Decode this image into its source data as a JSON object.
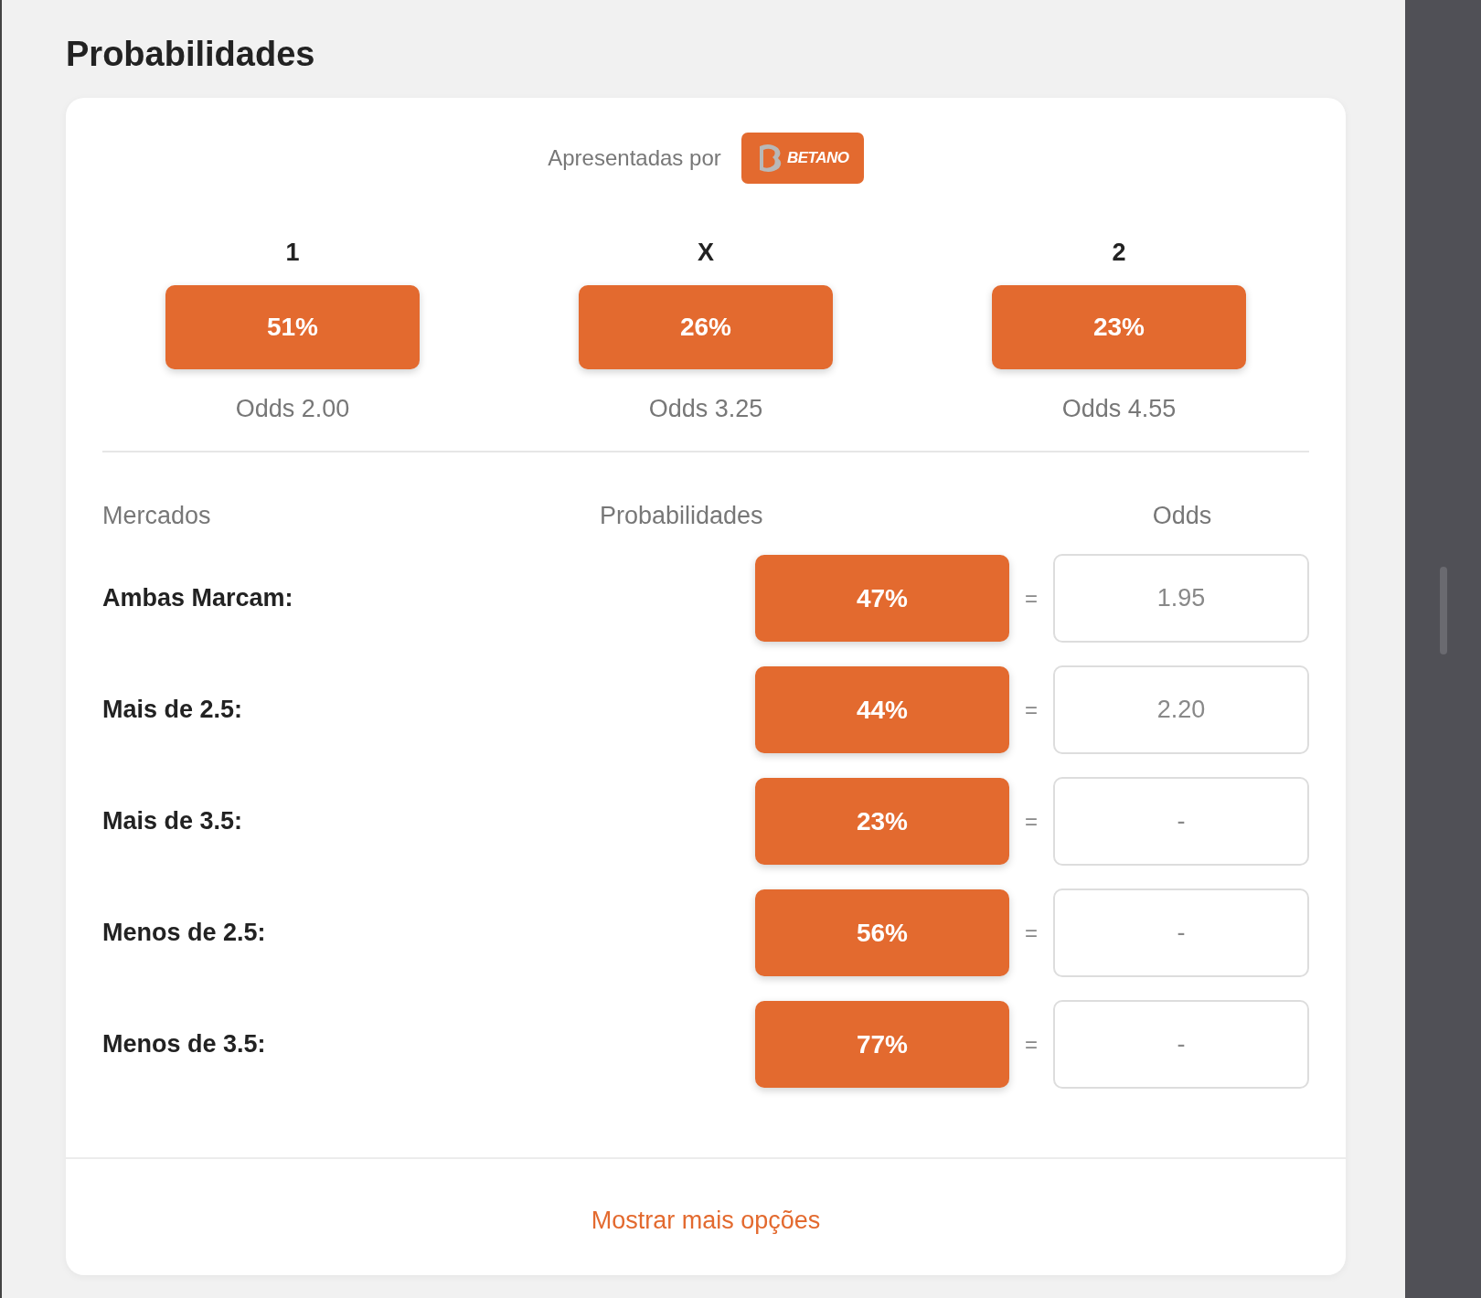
{
  "title": "Probabilidades",
  "sponsor": {
    "label": "Apresentadas por",
    "brand": "BETANO"
  },
  "outcomes": [
    {
      "label": "1",
      "probability": "51%",
      "odds": "Odds 2.00"
    },
    {
      "label": "X",
      "probability": "26%",
      "odds": "Odds 3.25"
    },
    {
      "label": "2",
      "probability": "23%",
      "odds": "Odds 4.55"
    }
  ],
  "markets": {
    "columns": [
      "Mercados",
      "Probabilidades",
      "Odds"
    ],
    "rows": [
      {
        "name": "Ambas Marcam:",
        "probability": "47%",
        "equals": "=",
        "odds": "1.95"
      },
      {
        "name": "Mais de 2.5:",
        "probability": "44%",
        "equals": "=",
        "odds": "2.20"
      },
      {
        "name": "Mais de 3.5:",
        "probability": "23%",
        "equals": "=",
        "odds": "-"
      },
      {
        "name": "Menos de 2.5:",
        "probability": "56%",
        "equals": "=",
        "odds": "-"
      },
      {
        "name": "Menos de 3.5:",
        "probability": "77%",
        "equals": "=",
        "odds": "-"
      }
    ]
  },
  "more_link": "Mostrar mais opções"
}
